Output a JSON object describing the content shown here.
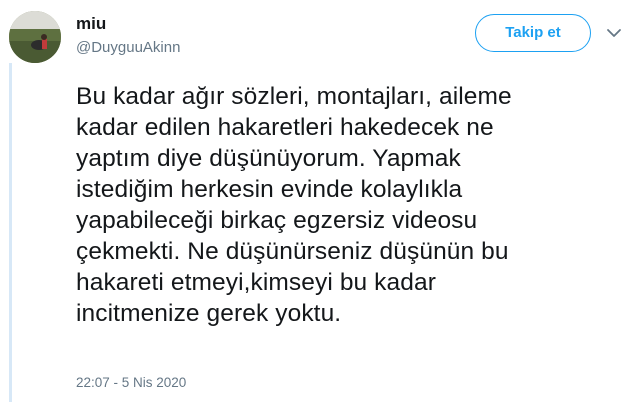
{
  "user": {
    "display_name": "miu",
    "handle": "@DuyguuAkinn",
    "avatar_icon": "profile-photo"
  },
  "actions": {
    "follow_label": "Takip et",
    "menu_icon": "chevron-down-icon"
  },
  "tweet": {
    "text": "Bu kadar ağır sözleri, montajları, aileme\nkadar edilen hakaretleri hakedecek ne\nyaptım diye düşünüyorum. Yapmak\nistediğim herkesin evinde kolaylıkla\nyapabileceği birkaç egzersiz videosu\nçekmekti. Ne düşünürseniz düşünün bu\nhakareti etmeyi,kimseyi bu kadar\nincitmenize gerek yoktu.",
    "timestamp": "22:07 - 5 Nis 2020"
  },
  "colors": {
    "accent": "#1da1f2",
    "secondary_text": "#657786",
    "primary_text": "#14171a",
    "thread_bar": "#d7e8f7"
  }
}
